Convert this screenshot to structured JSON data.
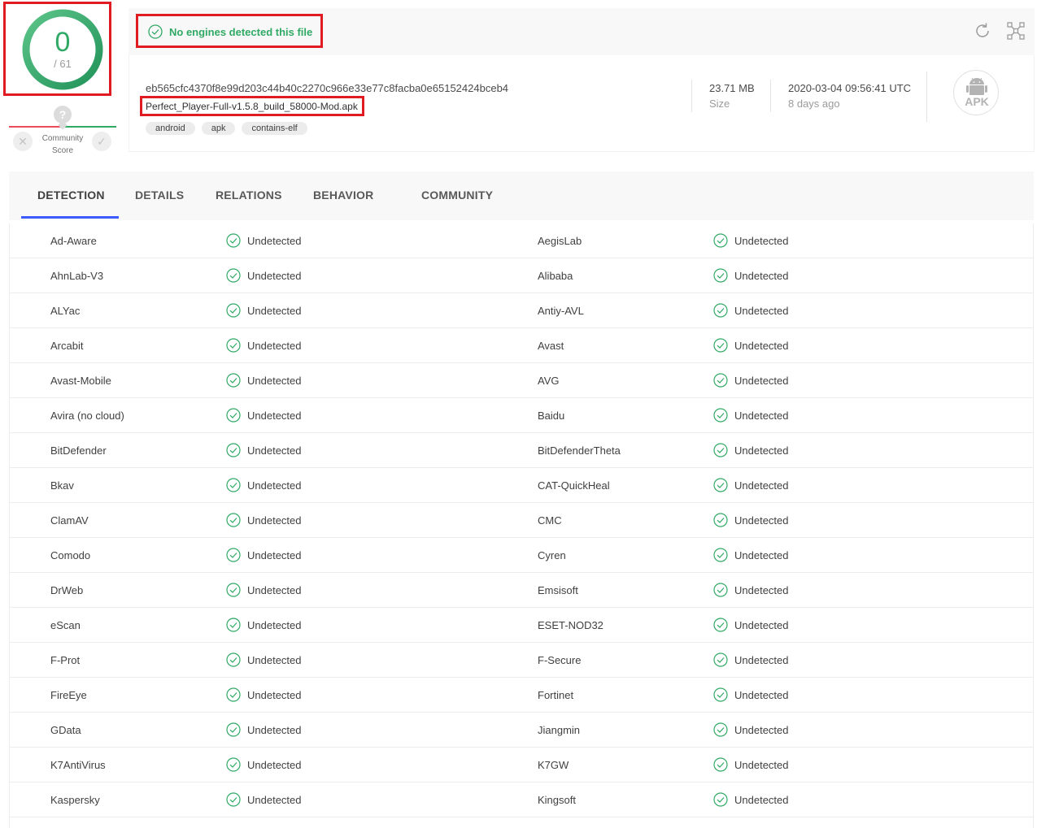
{
  "score": {
    "detections": "0",
    "total": "/ 61"
  },
  "community": {
    "question_mark": "?",
    "label_line1": "Community",
    "label_line2": "Score"
  },
  "status": {
    "text": "No engines detected this file"
  },
  "file": {
    "hash": "eb565cfc4370f8e99d203c44b40c2270c966e33e77c8facba0e65152424bceb4",
    "name": "Perfect_Player-Full-v1.5.8_build_58000-Mod.apk",
    "tags": [
      "android",
      "apk",
      "contains-elf"
    ],
    "size_value": "23.71 MB",
    "size_label": "Size",
    "date_value": "2020-03-04 09:56:41 UTC",
    "date_label": "8 days ago",
    "type_badge": "APK"
  },
  "tabs": [
    "DETECTION",
    "DETAILS",
    "RELATIONS",
    "BEHAVIOR",
    "COMMUNITY"
  ],
  "rows": [
    {
      "left_engine": "Ad-Aware",
      "left_result": "Undetected",
      "right_engine": "AegisLab",
      "right_result": "Undetected"
    },
    {
      "left_engine": "AhnLab-V3",
      "left_result": "Undetected",
      "right_engine": "Alibaba",
      "right_result": "Undetected"
    },
    {
      "left_engine": "ALYac",
      "left_result": "Undetected",
      "right_engine": "Antiy-AVL",
      "right_result": "Undetected"
    },
    {
      "left_engine": "Arcabit",
      "left_result": "Undetected",
      "right_engine": "Avast",
      "right_result": "Undetected"
    },
    {
      "left_engine": "Avast-Mobile",
      "left_result": "Undetected",
      "right_engine": "AVG",
      "right_result": "Undetected"
    },
    {
      "left_engine": "Avira (no cloud)",
      "left_result": "Undetected",
      "right_engine": "Baidu",
      "right_result": "Undetected"
    },
    {
      "left_engine": "BitDefender",
      "left_result": "Undetected",
      "right_engine": "BitDefenderTheta",
      "right_result": "Undetected"
    },
    {
      "left_engine": "Bkav",
      "left_result": "Undetected",
      "right_engine": "CAT-QuickHeal",
      "right_result": "Undetected"
    },
    {
      "left_engine": "ClamAV",
      "left_result": "Undetected",
      "right_engine": "CMC",
      "right_result": "Undetected"
    },
    {
      "left_engine": "Comodo",
      "left_result": "Undetected",
      "right_engine": "Cyren",
      "right_result": "Undetected"
    },
    {
      "left_engine": "DrWeb",
      "left_result": "Undetected",
      "right_engine": "Emsisoft",
      "right_result": "Undetected"
    },
    {
      "left_engine": "eScan",
      "left_result": "Undetected",
      "right_engine": "ESET-NOD32",
      "right_result": "Undetected"
    },
    {
      "left_engine": "F-Prot",
      "left_result": "Undetected",
      "right_engine": "F-Secure",
      "right_result": "Undetected"
    },
    {
      "left_engine": "FireEye",
      "left_result": "Undetected",
      "right_engine": "Fortinet",
      "right_result": "Undetected"
    },
    {
      "left_engine": "GData",
      "left_result": "Undetected",
      "right_engine": "Jiangmin",
      "right_result": "Undetected"
    },
    {
      "left_engine": "K7AntiVirus",
      "left_result": "Undetected",
      "right_engine": "K7GW",
      "right_result": "Undetected"
    },
    {
      "left_engine": "Kaspersky",
      "left_result": "Undetected",
      "right_engine": "Kingsoft",
      "right_result": "Undetected"
    }
  ],
  "colors": {
    "clean": "#30a965",
    "malicious": "#ea4a5a",
    "accent": "#3d5afe",
    "highlight": "#e11b22"
  },
  "icons": {
    "status": "check-circle-icon",
    "reanalyze": "reanalyze-icon",
    "similar": "similar-files-icon",
    "filetype": "apk-file-icon"
  }
}
